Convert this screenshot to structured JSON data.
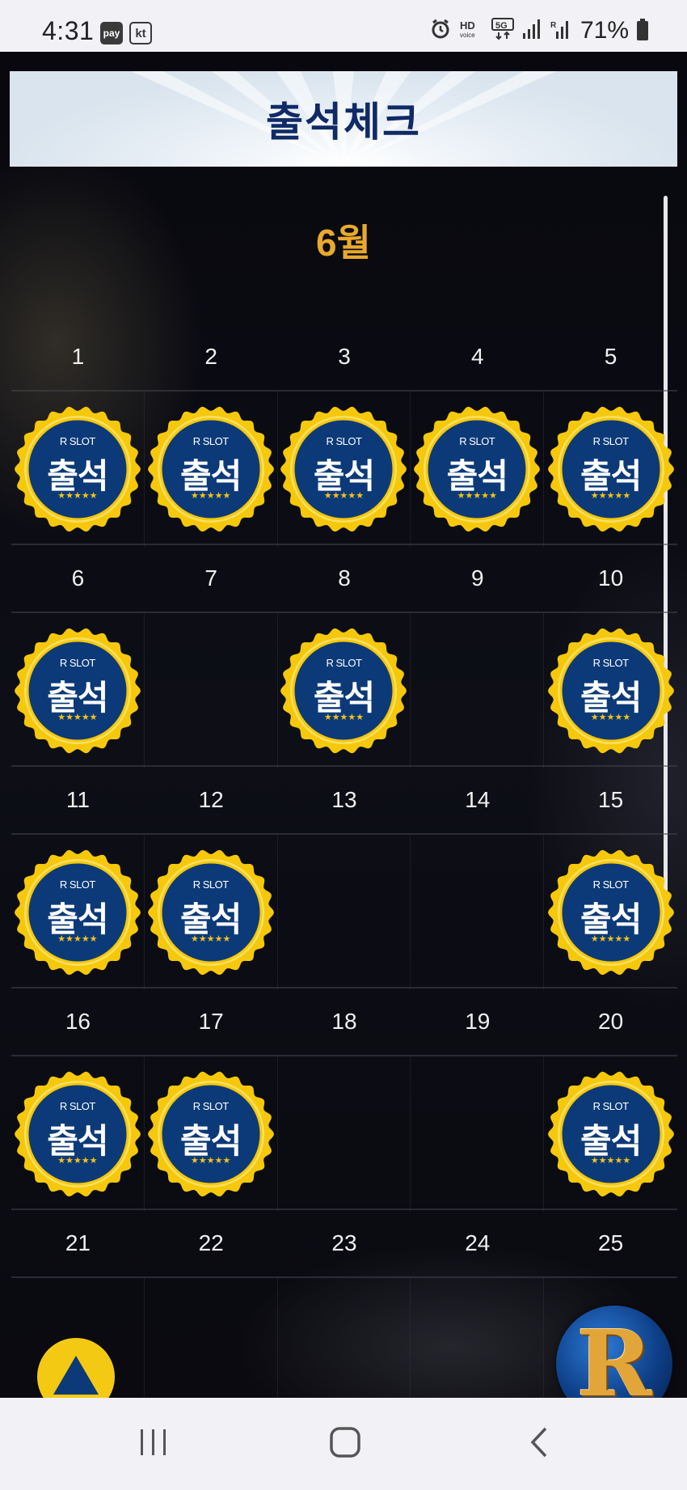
{
  "status_bar": {
    "time": "4:31",
    "pay_badge": "pay",
    "carrier_badge": "kt",
    "battery": "71%",
    "icons": [
      "alarm-icon",
      "hd-voice-icon",
      "5g-icon",
      "signal-icon",
      "signal-r-icon",
      "battery-icon"
    ]
  },
  "header": {
    "title": "출석체크"
  },
  "calendar": {
    "month": "6월",
    "weeks": [
      {
        "days": [
          {
            "day": "1",
            "stamped": true
          },
          {
            "day": "2",
            "stamped": true
          },
          {
            "day": "3",
            "stamped": true
          },
          {
            "day": "4",
            "stamped": true
          },
          {
            "day": "5",
            "stamped": true
          }
        ]
      },
      {
        "days": [
          {
            "day": "6",
            "stamped": true
          },
          {
            "day": "7",
            "stamped": false
          },
          {
            "day": "8",
            "stamped": true
          },
          {
            "day": "9",
            "stamped": false
          },
          {
            "day": "10",
            "stamped": true
          }
        ]
      },
      {
        "days": [
          {
            "day": "11",
            "stamped": true
          },
          {
            "day": "12",
            "stamped": true
          },
          {
            "day": "13",
            "stamped": false
          },
          {
            "day": "14",
            "stamped": false
          },
          {
            "day": "15",
            "stamped": true
          }
        ]
      },
      {
        "days": [
          {
            "day": "16",
            "stamped": true
          },
          {
            "day": "17",
            "stamped": true
          },
          {
            "day": "18",
            "stamped": false
          },
          {
            "day": "19",
            "stamped": false
          },
          {
            "day": "20",
            "stamped": true
          }
        ]
      },
      {
        "days": [
          {
            "day": "21",
            "stamped": false
          },
          {
            "day": "22",
            "stamped": false
          },
          {
            "day": "23",
            "stamped": false
          },
          {
            "day": "24",
            "stamped": false
          },
          {
            "day": "25",
            "stamped": false
          }
        ]
      }
    ],
    "stamp": {
      "brand": "R SLOT",
      "label": "출석",
      "stars": "★★★★★"
    }
  },
  "floating": {
    "scroll_top_icon": "triangle-up-icon",
    "logo_letter": "R"
  },
  "nav": {
    "recents_icon": "recents-icon",
    "home_icon": "home-icon",
    "back_icon": "back-icon"
  },
  "colors": {
    "stamp_ring": "#f5c80c",
    "stamp_center": "#0c3a78",
    "month_color": "#e9a92c",
    "title_color": "#0f2a66"
  }
}
